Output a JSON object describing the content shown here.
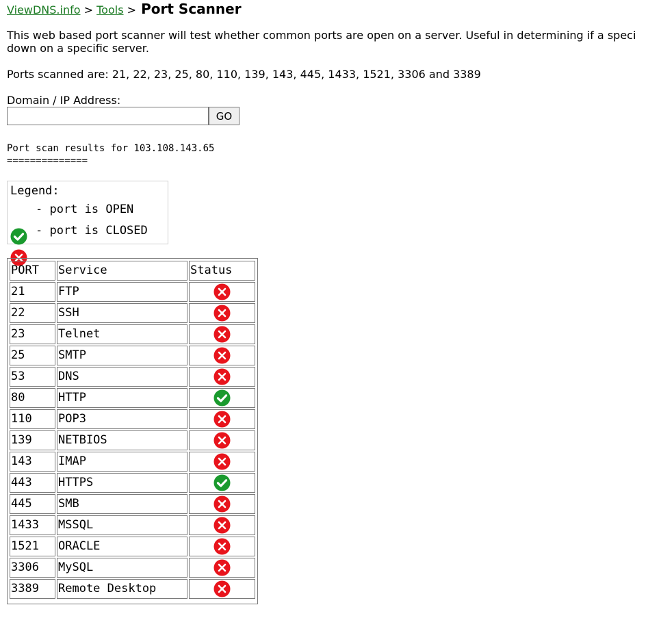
{
  "breadcrumb": {
    "home": "ViewDNS.info",
    "sep1": ">",
    "tools": "Tools",
    "sep2": ">",
    "title": "Port Scanner"
  },
  "description": "This web based port scanner will test whether common ports are open on a server. Useful in determining if a speci down on a specific server.",
  "ports_scanned": "Ports scanned are: 21, 22, 23, 25, 80, 110, 139, 143, 445, 1433, 1521, 3306 and 3389",
  "form": {
    "label": "Domain / IP Address:",
    "input_value": "",
    "go_label": "GO"
  },
  "results": {
    "heading": "Port scan results for 103.108.143.65",
    "underline": "=============="
  },
  "legend": {
    "title": "Legend:",
    "open_text": "- port is OPEN",
    "closed_text": "- port is CLOSED"
  },
  "colors": {
    "open": "#1a9a2e",
    "closed": "#e8141c",
    "link": "#1a7a22"
  },
  "table": {
    "headers": {
      "port": "PORT",
      "service": "Service",
      "status": "Status"
    },
    "rows": [
      {
        "port": "21",
        "service": "FTP",
        "status": "closed"
      },
      {
        "port": "22",
        "service": "SSH",
        "status": "closed"
      },
      {
        "port": "23",
        "service": "Telnet",
        "status": "closed"
      },
      {
        "port": "25",
        "service": "SMTP",
        "status": "closed"
      },
      {
        "port": "53",
        "service": "DNS",
        "status": "closed"
      },
      {
        "port": "80",
        "service": "HTTP",
        "status": "open"
      },
      {
        "port": "110",
        "service": "POP3",
        "status": "closed"
      },
      {
        "port": "139",
        "service": "NETBIOS",
        "status": "closed"
      },
      {
        "port": "143",
        "service": "IMAP",
        "status": "closed"
      },
      {
        "port": "443",
        "service": "HTTPS",
        "status": "open"
      },
      {
        "port": "445",
        "service": "SMB",
        "status": "closed"
      },
      {
        "port": "1433",
        "service": "MSSQL",
        "status": "closed"
      },
      {
        "port": "1521",
        "service": "ORACLE",
        "status": "closed"
      },
      {
        "port": "3306",
        "service": "MySQL",
        "status": "closed"
      },
      {
        "port": "3389",
        "service": "Remote Desktop",
        "status": "closed"
      }
    ]
  }
}
